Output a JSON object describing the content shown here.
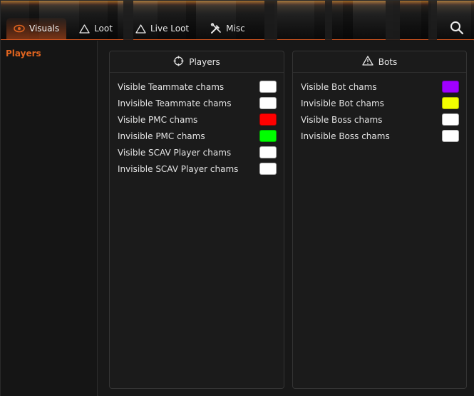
{
  "tabs": [
    {
      "label": "Visuals",
      "icon": "eye-icon",
      "active": true
    },
    {
      "label": "Loot",
      "icon": "warning-triangle-icon",
      "active": false
    },
    {
      "label": "Live Loot",
      "icon": "warning-triangle-icon",
      "active": false
    },
    {
      "label": "Misc",
      "icon": "tools-icon",
      "active": false
    }
  ],
  "search_icon": "search-icon",
  "sidebar": {
    "items": [
      {
        "label": "Players",
        "active": true
      }
    ]
  },
  "accent_color": "#e0641f",
  "panels": {
    "players": {
      "title": "Players",
      "icon": "crosshair-icon",
      "rows": [
        {
          "label": "Visible Teammate chams",
          "color": "#ffffff"
        },
        {
          "label": "Invisible Teammate chams",
          "color": "#ffffff"
        },
        {
          "label": "Visible PMC chams",
          "color": "#ff0000"
        },
        {
          "label": "Invisible PMC chams",
          "color": "#00ff00"
        },
        {
          "label": "Visible SCAV Player chams",
          "color": "#ffffff"
        },
        {
          "label": "Invisible SCAV Player chams",
          "color": "#ffffff"
        }
      ]
    },
    "bots": {
      "title": "Bots",
      "icon": "warning-triangle-icon",
      "rows": [
        {
          "label": "Visible Bot chams",
          "color": "#a000ff"
        },
        {
          "label": "Invisible Bot chams",
          "color": "#f2ff00"
        },
        {
          "label": "Visible Boss chams",
          "color": "#ffffff"
        },
        {
          "label": "Invisible Boss chams",
          "color": "#ffffff"
        }
      ]
    }
  }
}
